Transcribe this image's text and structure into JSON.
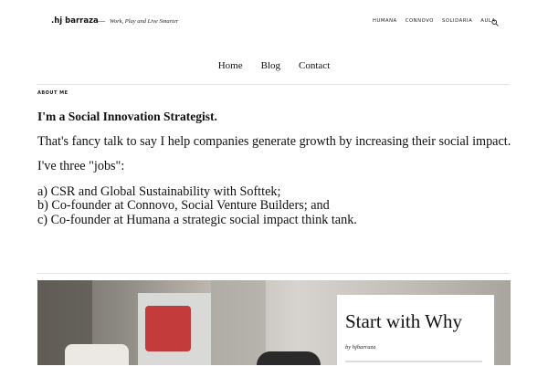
{
  "header": {
    "brand": ".hj barraza",
    "dash": "—",
    "tagline": "Work, Play and Live Smarter",
    "links": [
      "HUMANA",
      "CONNOVO",
      "SOLIDARIA",
      "AULA"
    ]
  },
  "nav": {
    "items": [
      "Home",
      "Blog",
      "Contact"
    ]
  },
  "about": {
    "label": "ABOUT ME",
    "headline": "I'm a Social Innovation Strategist.",
    "intro": "That's fancy talk to say I help companies generate growth by increasing their social impact.",
    "jobs_intro": "I've three \"jobs\":",
    "jobs": [
      "a) CSR and Global Sustainability with Softtek;",
      "b) Co-founder at Connovo, Social Venture Builders; and",
      "c) Co-founder at Humana a strategic social impact think tank."
    ]
  },
  "featured": {
    "title": "Start with Why",
    "byline": "by hjbarraza"
  }
}
